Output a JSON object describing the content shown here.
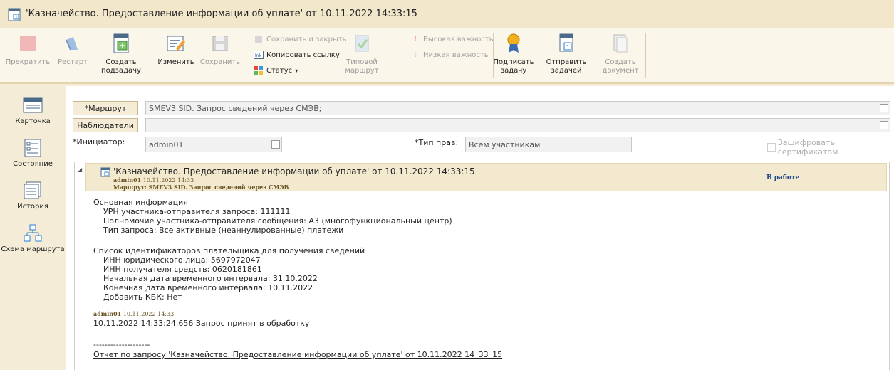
{
  "window": {
    "title": "'Казначейство. Предоставление информации об уплате' от 10.11.2022 14:33:15"
  },
  "ribbon": {
    "stop": "Прекратить",
    "restart": "Рестарт",
    "create_subtask_l1": "Создать",
    "create_subtask_l2": "подзадачу",
    "edit": "Изменить",
    "save": "Сохранить",
    "save_close": "Сохранить и закрыть",
    "copy_link": "Копировать ссылку",
    "status": "Статус",
    "typical_route_l1": "Типовой",
    "typical_route_l2": "маршрут",
    "high_importance": "Высокая важность",
    "low_importance": "Низкая важность",
    "sign_task_l1": "Подписать",
    "sign_task_l2": "задачу",
    "send_task_l1": "Отправить",
    "send_task_l2": "задачей",
    "create_doc_l1": "Создать",
    "create_doc_l2": "документ"
  },
  "nav": {
    "card": "Карточка",
    "state": "Состояние",
    "history": "История",
    "route_scheme": "Схема маршрута"
  },
  "form": {
    "route_label": "*Маршрут",
    "route_value": "SMEV3 SID. Запрос сведений через СМЭВ;",
    "observers_label": "Наблюдатели",
    "observers_value": "",
    "initiator_label": "*Инициатор:",
    "initiator_value": "admin01",
    "rights_label": "*Тип прав:",
    "rights_value": "Всем участникам",
    "encrypt_label": "Зашифровать сертификатом"
  },
  "task": {
    "title": "'Казначейство. Предоставление информации об уплате' от 10.11.2022 14:33:15",
    "author": "admin01",
    "date": "10.11.2022 14:33",
    "route_line": "Маршрут: SMEV3 SID. Запрос сведений через СМЭВ",
    "status": "В работе",
    "lines": [
      "Основная информация",
      "УРН участника-отправителя запроса: 111111",
      "Полномочие участника-отправителя сообщения: A3 (многофункциональный центр)",
      "Тип запроса: Все активные (неаннулированные) платежи",
      "Список идентификаторов плательщика для получения сведений",
      "ИНН юридического лица: 5697972047",
      "ИНН получателя средств: 0620181861",
      "Начальная дата временного интервала: 31.10.2022",
      "Конечная дата временного интервала: 10.11.2022",
      "Добавить КБК: Нет"
    ],
    "comment_author": "admin01",
    "comment_date": "10.11.2022 14:33",
    "comment_text": "10.11.2022 14:33:24.656 Запрос принят в обработку",
    "separator": "--------------------",
    "report_link": "Отчет по запросу 'Казначейство. Предоставление информации об уплате' от 10.11.2022 14_33_15"
  }
}
